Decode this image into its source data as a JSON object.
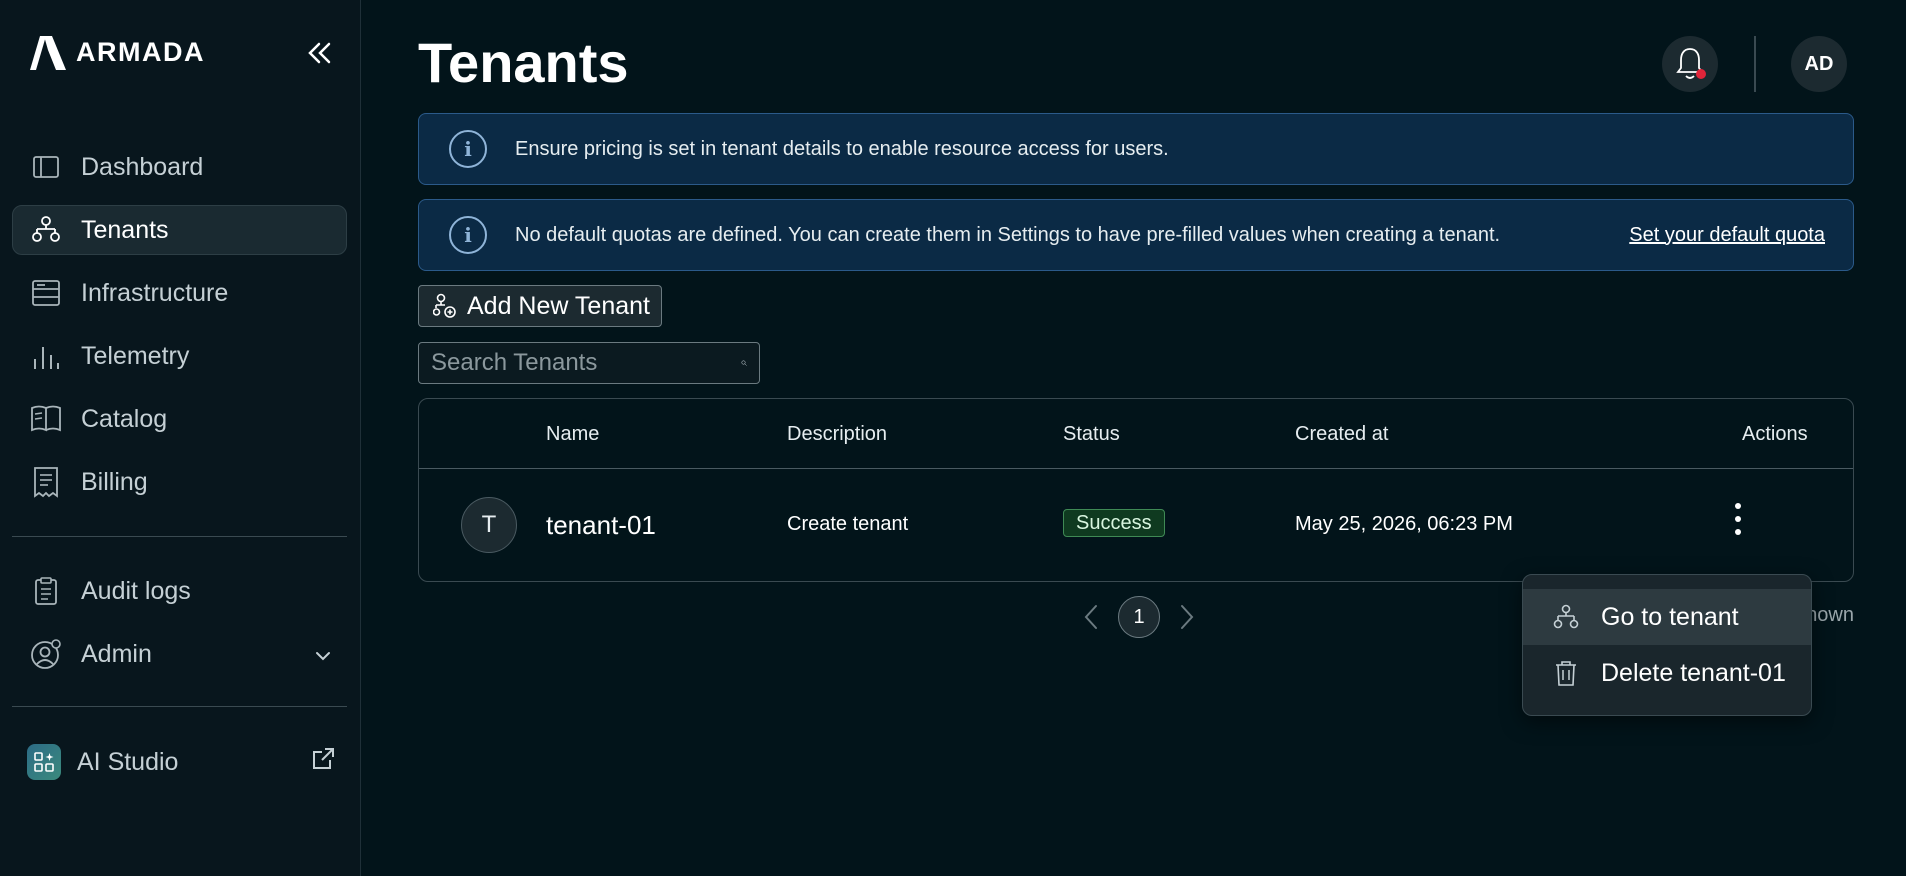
{
  "brand": {
    "name": "ARMADA"
  },
  "sidebar": {
    "items": [
      {
        "label": "Dashboard",
        "icon": "dashboard-icon"
      },
      {
        "label": "Tenants",
        "icon": "tenants-icon",
        "active": true
      },
      {
        "label": "Infrastructure",
        "icon": "server-icon"
      },
      {
        "label": "Telemetry",
        "icon": "bar-chart-icon"
      },
      {
        "label": "Catalog",
        "icon": "catalog-icon"
      },
      {
        "label": "Billing",
        "icon": "receipt-icon"
      }
    ],
    "secondary": [
      {
        "label": "Audit logs",
        "icon": "clipboard-icon"
      },
      {
        "label": "Admin",
        "icon": "user-gear-icon"
      }
    ],
    "apps": [
      {
        "label": "AI Studio",
        "icon": "apps-icon"
      }
    ]
  },
  "header": {
    "title": "Tenants",
    "avatar_initials": "AD"
  },
  "banners": [
    {
      "text": "Ensure pricing is set in tenant details to enable resource access for users."
    },
    {
      "text": "No default quotas are defined. You can create them in Settings to have pre-filled values when creating a tenant.",
      "link": "Set your default quota"
    }
  ],
  "actions": {
    "add_label": "Add New Tenant"
  },
  "search": {
    "placeholder": "Search Tenants"
  },
  "table": {
    "columns": [
      "Name",
      "Description",
      "Status",
      "Created at",
      "Actions"
    ],
    "rows": [
      {
        "initial": "T",
        "name": "tenant-01",
        "description": "Create tenant",
        "status": "Success",
        "created_at": "May 25, 2026, 06:23 PM"
      }
    ]
  },
  "pagination": {
    "current_page": "1",
    "shown_text": "hown"
  },
  "context_menu": {
    "items": [
      {
        "label": "Go to tenant"
      },
      {
        "label": "Delete tenant-01"
      }
    ]
  },
  "colors": {
    "background": "#02141a",
    "sidebar": "#08161d",
    "banner": "#0b2a45",
    "success": "#0f3a20",
    "notification_dot": "#e0253a"
  }
}
